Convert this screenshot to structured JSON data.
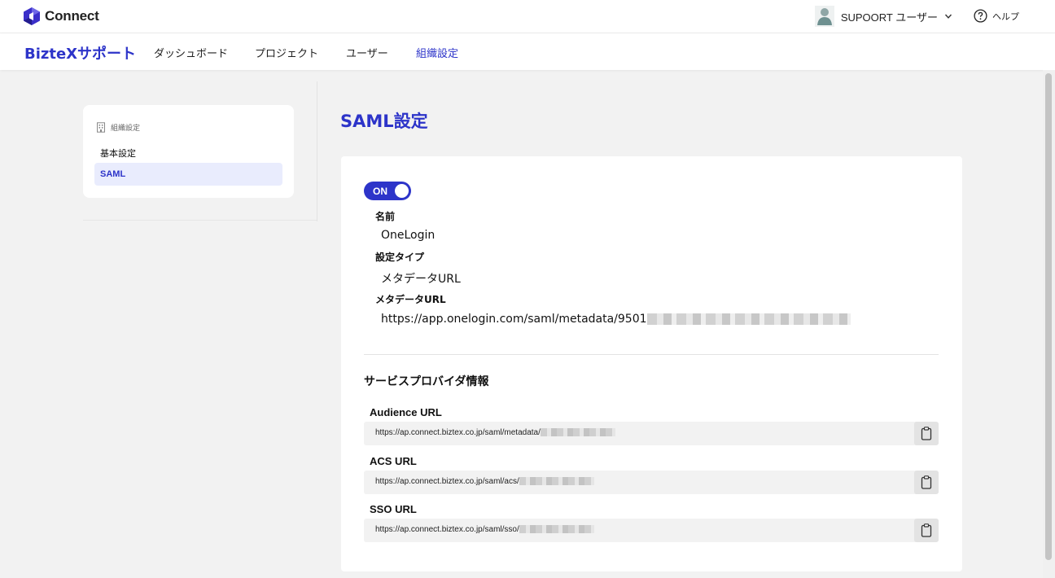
{
  "header": {
    "app_name": "Connect",
    "user_name": "SUPOORT ユーザー",
    "help_label": "ヘルプ"
  },
  "nav": {
    "brand": "BizteXサポート",
    "items": [
      {
        "label": "ダッシュボード"
      },
      {
        "label": "プロジェクト"
      },
      {
        "label": "ユーザー"
      },
      {
        "label": "組織設定"
      }
    ]
  },
  "sidebar": {
    "heading": "組織設定",
    "items": [
      {
        "label": "基本設定"
      },
      {
        "label": "SAML"
      }
    ]
  },
  "main": {
    "title": "SAML設定",
    "toggle_label": "ON",
    "fields": [
      {
        "label": "名前",
        "value": "OneLogin"
      },
      {
        "label": "設定タイプ",
        "value": "メタデータURL"
      },
      {
        "label": "メタデータURL",
        "value": "https://app.onelogin.com/saml/metadata/9501"
      }
    ],
    "sp_title": "サービスプロバイダ情報",
    "sp_urls": [
      {
        "label": "Audience URL",
        "value": "https://ap.connect.biztex.co.jp/saml/metadata/"
      },
      {
        "label": "ACS URL",
        "value": "https://ap.connect.biztex.co.jp/saml/acs/"
      },
      {
        "label": "SSO URL",
        "value": "https://ap.connect.biztex.co.jp/saml/sso/"
      }
    ]
  },
  "colors": {
    "accent": "#2d34c9",
    "active_bg": "#e9ecfd",
    "page_bg": "#f2f2f2"
  }
}
